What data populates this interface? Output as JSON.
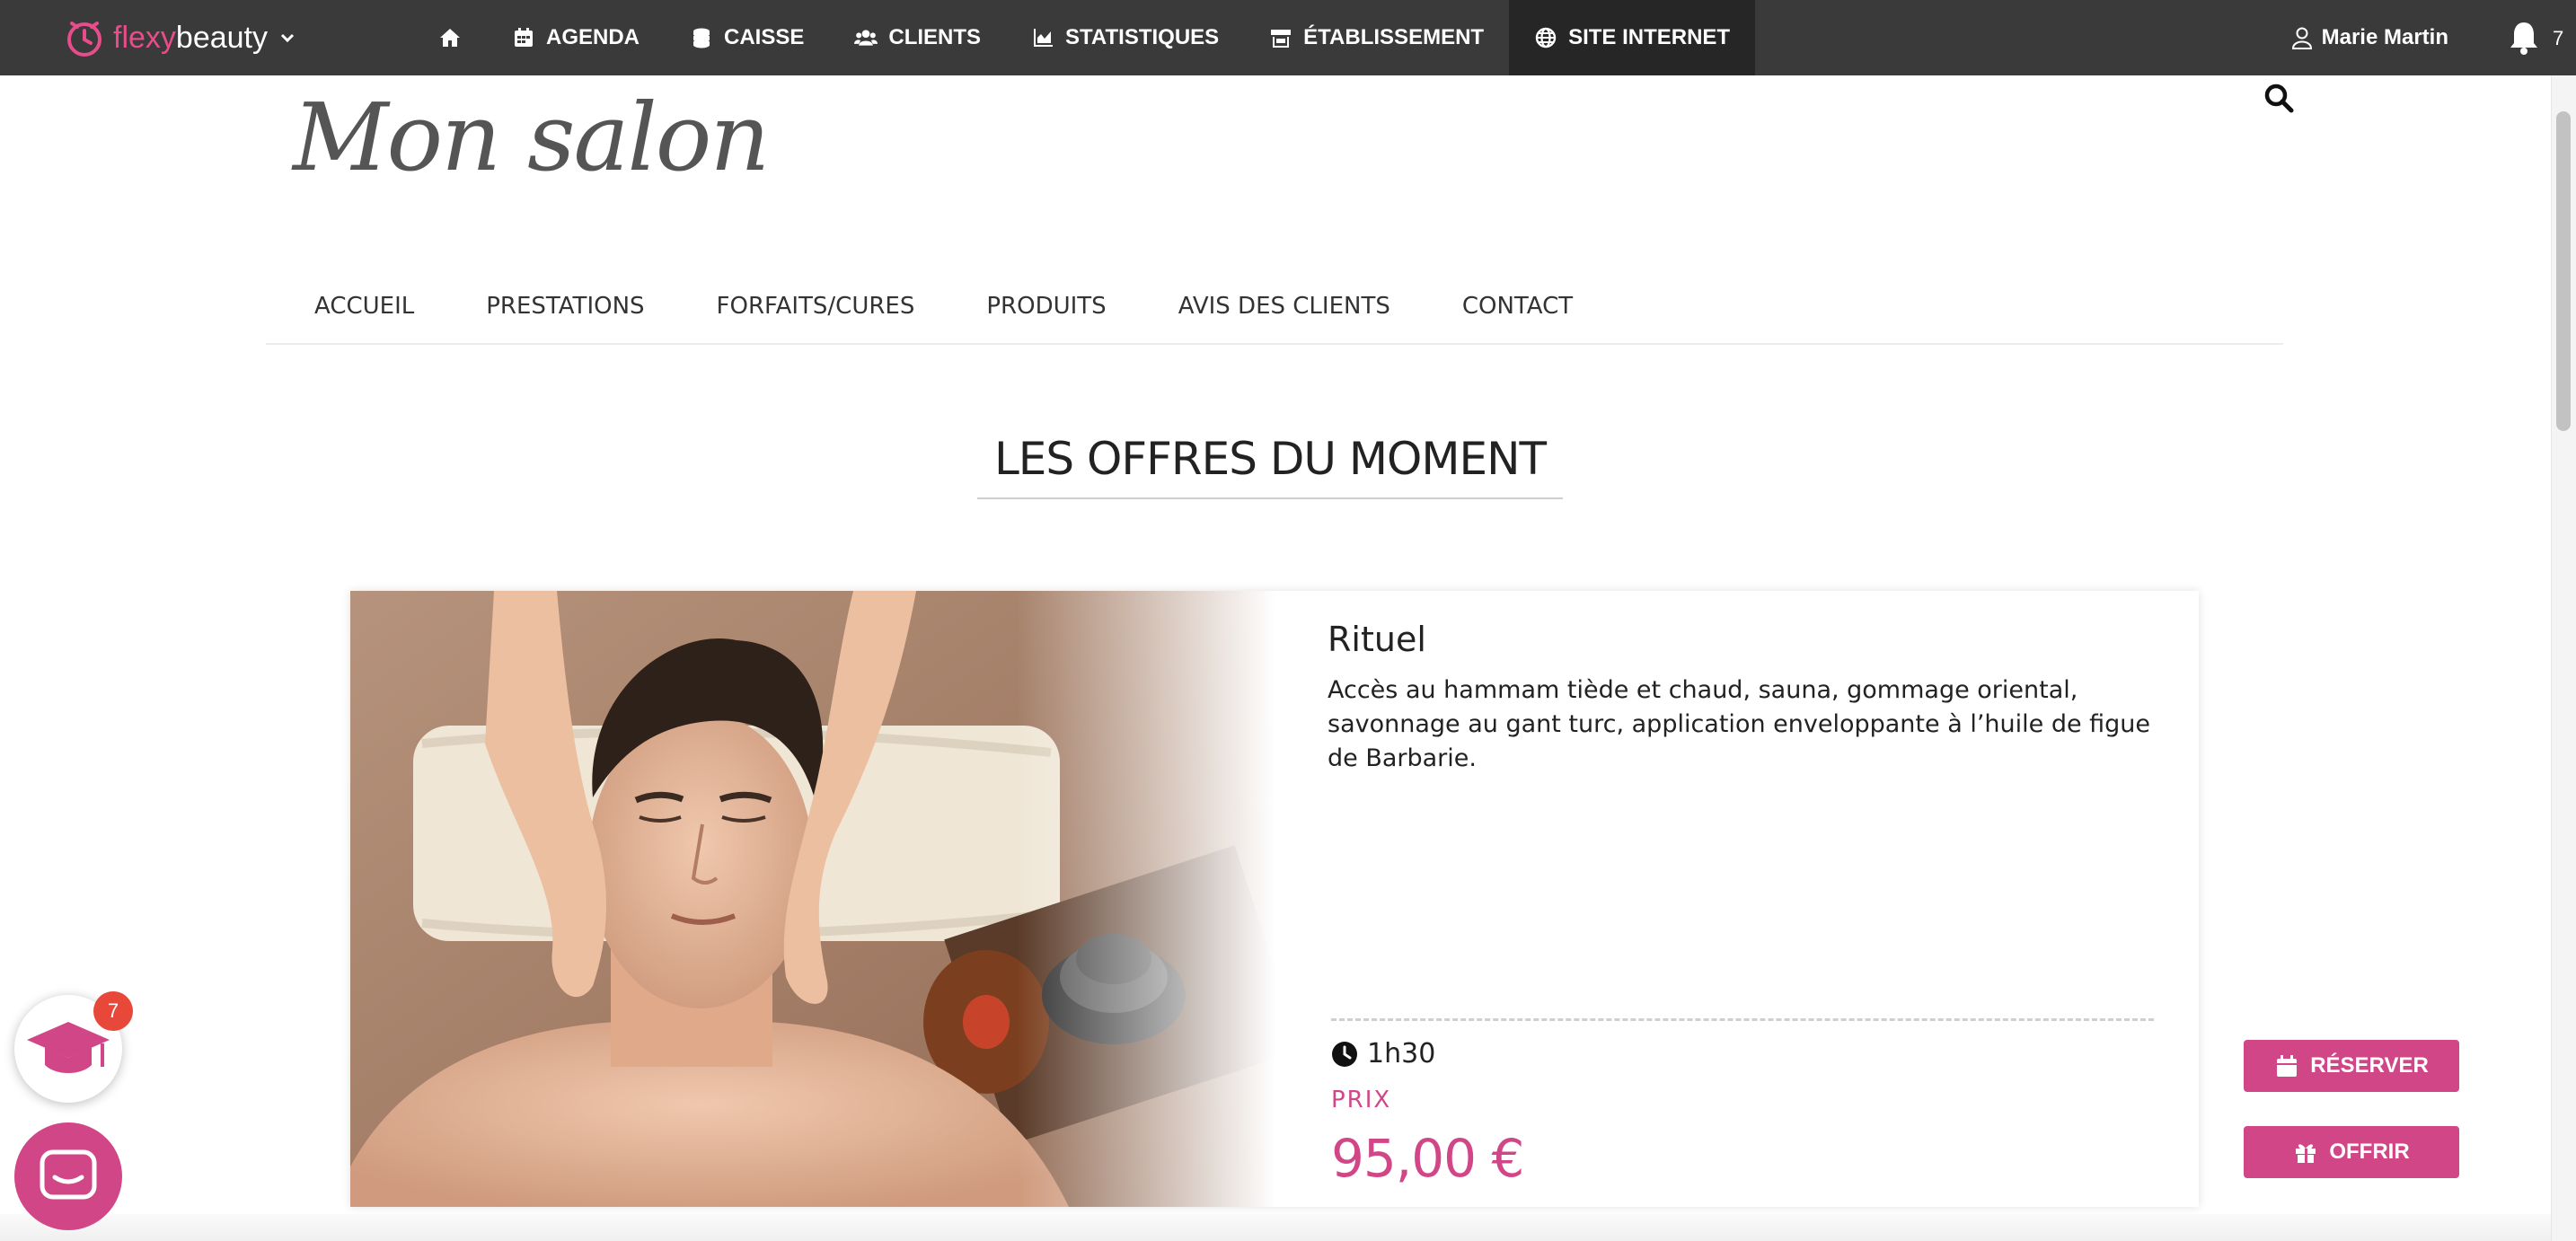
{
  "app": {
    "brand_part1": "flexy",
    "brand_part2": "beauty",
    "user_name": "Marie Martin",
    "notification_count": "7"
  },
  "topnav": {
    "items": [
      {
        "label": "",
        "icon": "home-icon"
      },
      {
        "label": "AGENDA",
        "icon": "calendar-icon"
      },
      {
        "label": "CAISSE",
        "icon": "coins-icon"
      },
      {
        "label": "CLIENTS",
        "icon": "users-icon"
      },
      {
        "label": "STATISTIQUES",
        "icon": "chart-icon"
      },
      {
        "label": "ÉTABLISSEMENT",
        "icon": "store-icon"
      },
      {
        "label": "SITE INTERNET",
        "icon": "globe-icon",
        "active": true
      }
    ]
  },
  "site": {
    "title": "Mon salon",
    "nav": [
      "ACCUEIL",
      "PRESTATIONS",
      "FORFAITS/CURES",
      "PRODUITS",
      "AVIS DES CLIENTS",
      "CONTACT"
    ]
  },
  "section": {
    "title": "LES OFFRES DU MOMENT"
  },
  "offer": {
    "name": "Rituel",
    "description": "Accès au hammam tiède et chaud, sauna, gommage oriental, savonnage au gant turc, application enveloppante à l’huile de figue de Barbarie.",
    "duration": "1h30",
    "price_label": "PRIX",
    "price": "95,00 €",
    "reserve_label": "RÉSERVER",
    "gift_label": "OFFRIR"
  },
  "widgets": {
    "academy_badge": "7"
  },
  "colors": {
    "topbar": "#3a3a3a",
    "accent_pink": "#d14687",
    "badge_red": "#e8483a"
  }
}
